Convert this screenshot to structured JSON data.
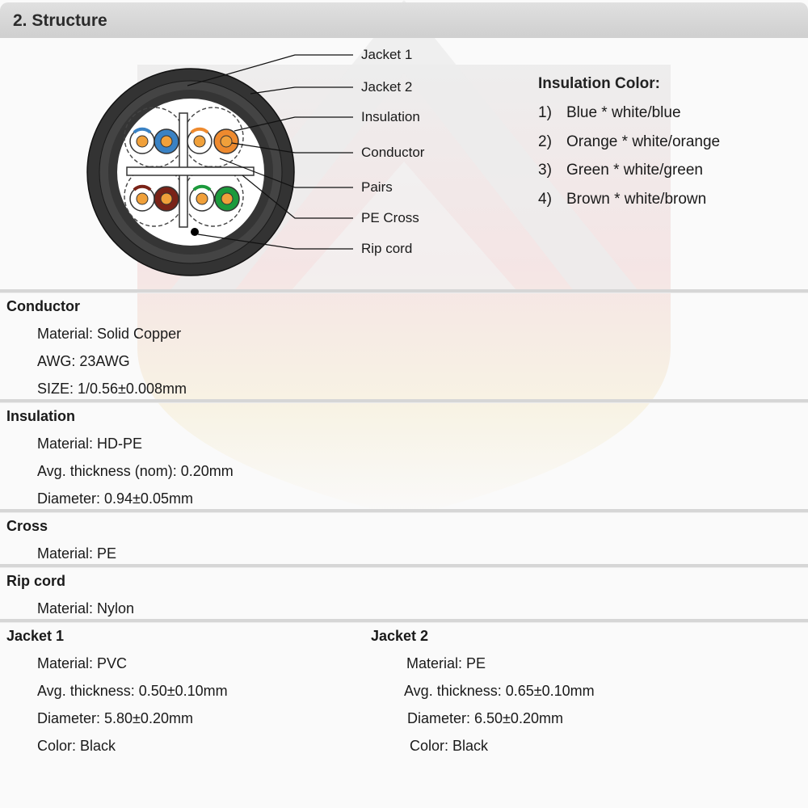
{
  "header": {
    "title": "2.  Structure"
  },
  "diagram": {
    "callouts": [
      "Jacket 1",
      "Jacket 2",
      "Insulation",
      "Conductor",
      "Pairs",
      "PE Cross",
      "Rip cord"
    ],
    "colors": {
      "jacket": "#333333",
      "blue": "#3a82c4",
      "orange": "#ee8a2e",
      "brown": "#7a2318",
      "green": "#1c9a3c",
      "conductor_core": "#f0a03a"
    }
  },
  "insulation_colors": {
    "title": "Insulation Color:",
    "items": [
      {
        "num": "1)",
        "text": "Blue * white/blue"
      },
      {
        "num": "2)",
        "text": "Orange * white/orange"
      },
      {
        "num": "3)",
        "text": "Green * white/green"
      },
      {
        "num": "4)",
        "text": "Brown * white/brown"
      }
    ]
  },
  "conductor": {
    "title": "Conductor",
    "props": [
      "Material: Solid Copper",
      "AWG: 23AWG",
      "SIZE: 1/0.56±0.008mm"
    ]
  },
  "insulation": {
    "title": "Insulation",
    "props": [
      "Material: HD-PE",
      "Avg. thickness (nom): 0.20mm",
      "Diameter: 0.94±0.05mm"
    ]
  },
  "cross": {
    "title": "Cross",
    "props": [
      "Material: PE"
    ]
  },
  "rip_cord": {
    "title": "Rip cord",
    "props": [
      "Material: Nylon"
    ]
  },
  "jacket1": {
    "title": "Jacket 1",
    "props": [
      "Material: PVC",
      "Avg. thickness: 0.50±0.10mm",
      "Diameter: 5.80±0.20mm",
      "Color: Black"
    ]
  },
  "jacket2": {
    "title": "Jacket 2",
    "props": [
      "Material: PE",
      "Avg. thickness: 0.65±0.10mm",
      "Diameter: 6.50±0.20mm",
      "Color: Black"
    ]
  }
}
